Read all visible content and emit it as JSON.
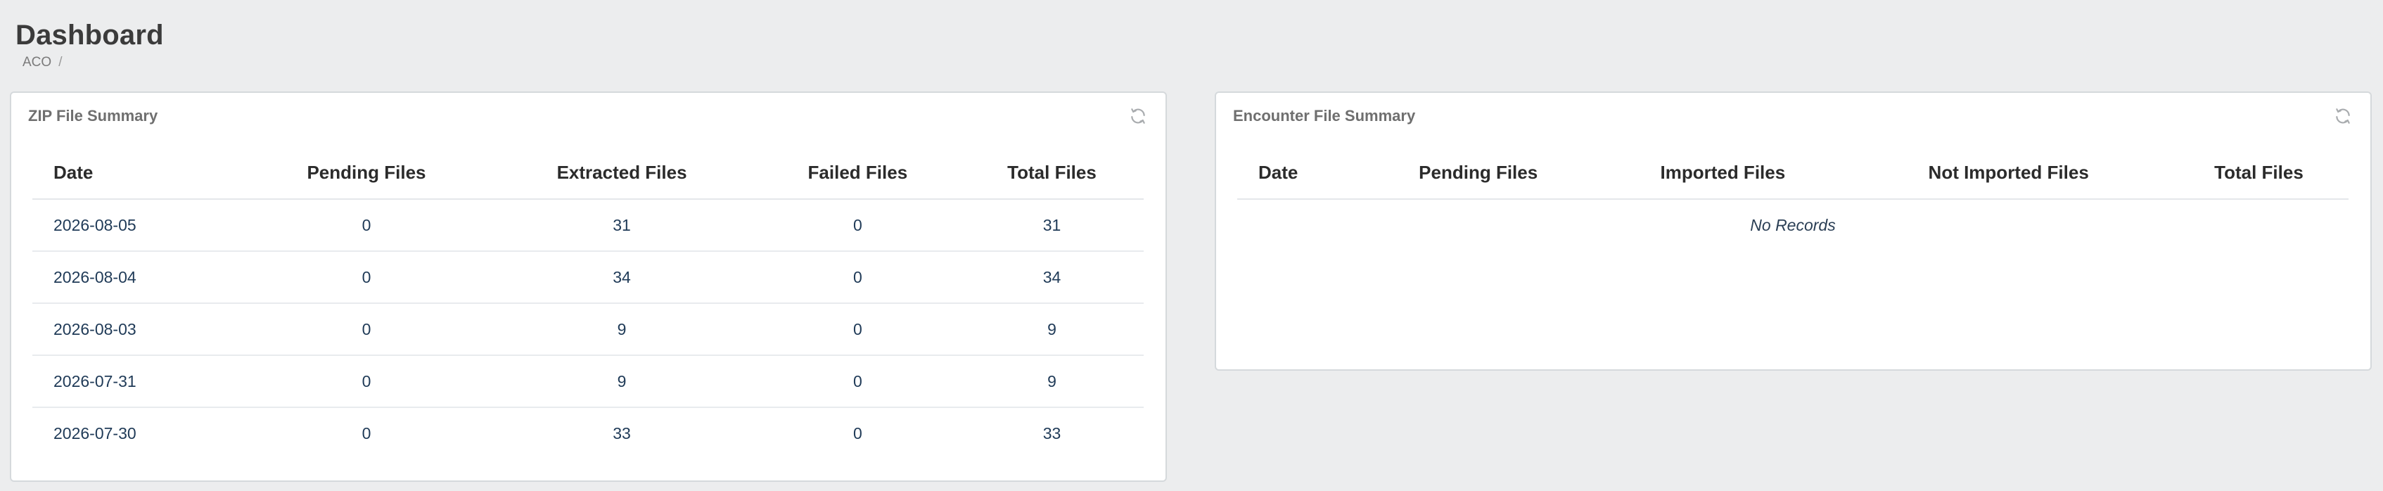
{
  "page": {
    "title": "Dashboard",
    "breadcrumb": [
      "ACO",
      "/"
    ]
  },
  "zip_summary": {
    "title": "ZIP File Summary",
    "refresh_icon": "refresh-icon",
    "columns": [
      "Date",
      "Pending Files",
      "Extracted Files",
      "Failed Files",
      "Total Files"
    ],
    "rows": [
      [
        "2026-08-05",
        "0",
        "31",
        "0",
        "31"
      ],
      [
        "2026-08-04",
        "0",
        "34",
        "0",
        "34"
      ],
      [
        "2026-08-03",
        "0",
        "9",
        "0",
        "9"
      ],
      [
        "2026-07-31",
        "0",
        "9",
        "0",
        "9"
      ],
      [
        "2026-07-30",
        "0",
        "33",
        "0",
        "33"
      ]
    ]
  },
  "encounter_summary": {
    "title": "Encounter File Summary",
    "refresh_icon": "refresh-icon",
    "columns": [
      "Date",
      "Pending Files",
      "Imported Files",
      "Not Imported Files",
      "Total Files"
    ],
    "empty_message": "No Records"
  }
}
